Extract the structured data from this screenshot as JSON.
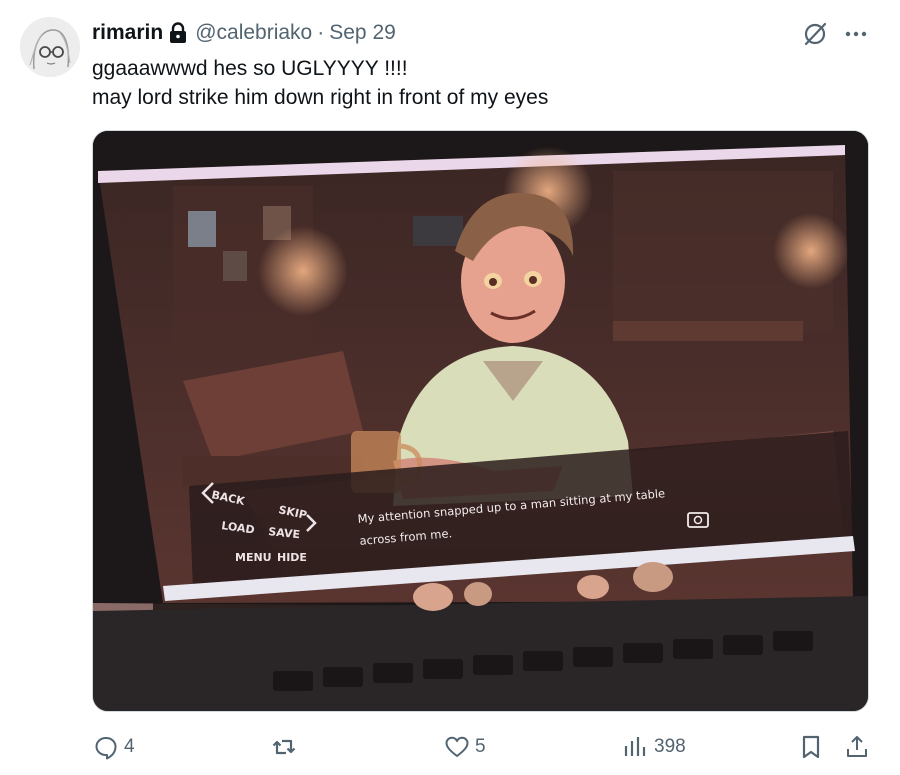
{
  "tweet": {
    "author": {
      "display_name": "rimarin",
      "handle": "@calebriako",
      "protected": true,
      "avatar_icon": "avatar-sketch"
    },
    "separator": "·",
    "date": "Sep 29",
    "text_lines": [
      "ggaaawwwd hes so UGLYYYY !!!!",
      "may lord strike him down right in front of my eyes"
    ],
    "header_icons": [
      "grok-icon",
      "more-icon"
    ],
    "media": {
      "kind": "photo of a laptop screen showing a visual novel",
      "game_ui": {
        "menu_items": [
          "BACK",
          "SKIP",
          "LOAD",
          "SAVE",
          "MENU",
          "HIDE"
        ],
        "dialogue_lines": [
          "My attention snapped up to a man sitting at my table",
          "across from me."
        ]
      }
    },
    "actions": {
      "replies": "4",
      "reposts": "",
      "likes": "5",
      "views": "398"
    },
    "colors": {
      "text": "#0f1419",
      "secondary": "#536471",
      "border": "#cfd9de"
    }
  }
}
